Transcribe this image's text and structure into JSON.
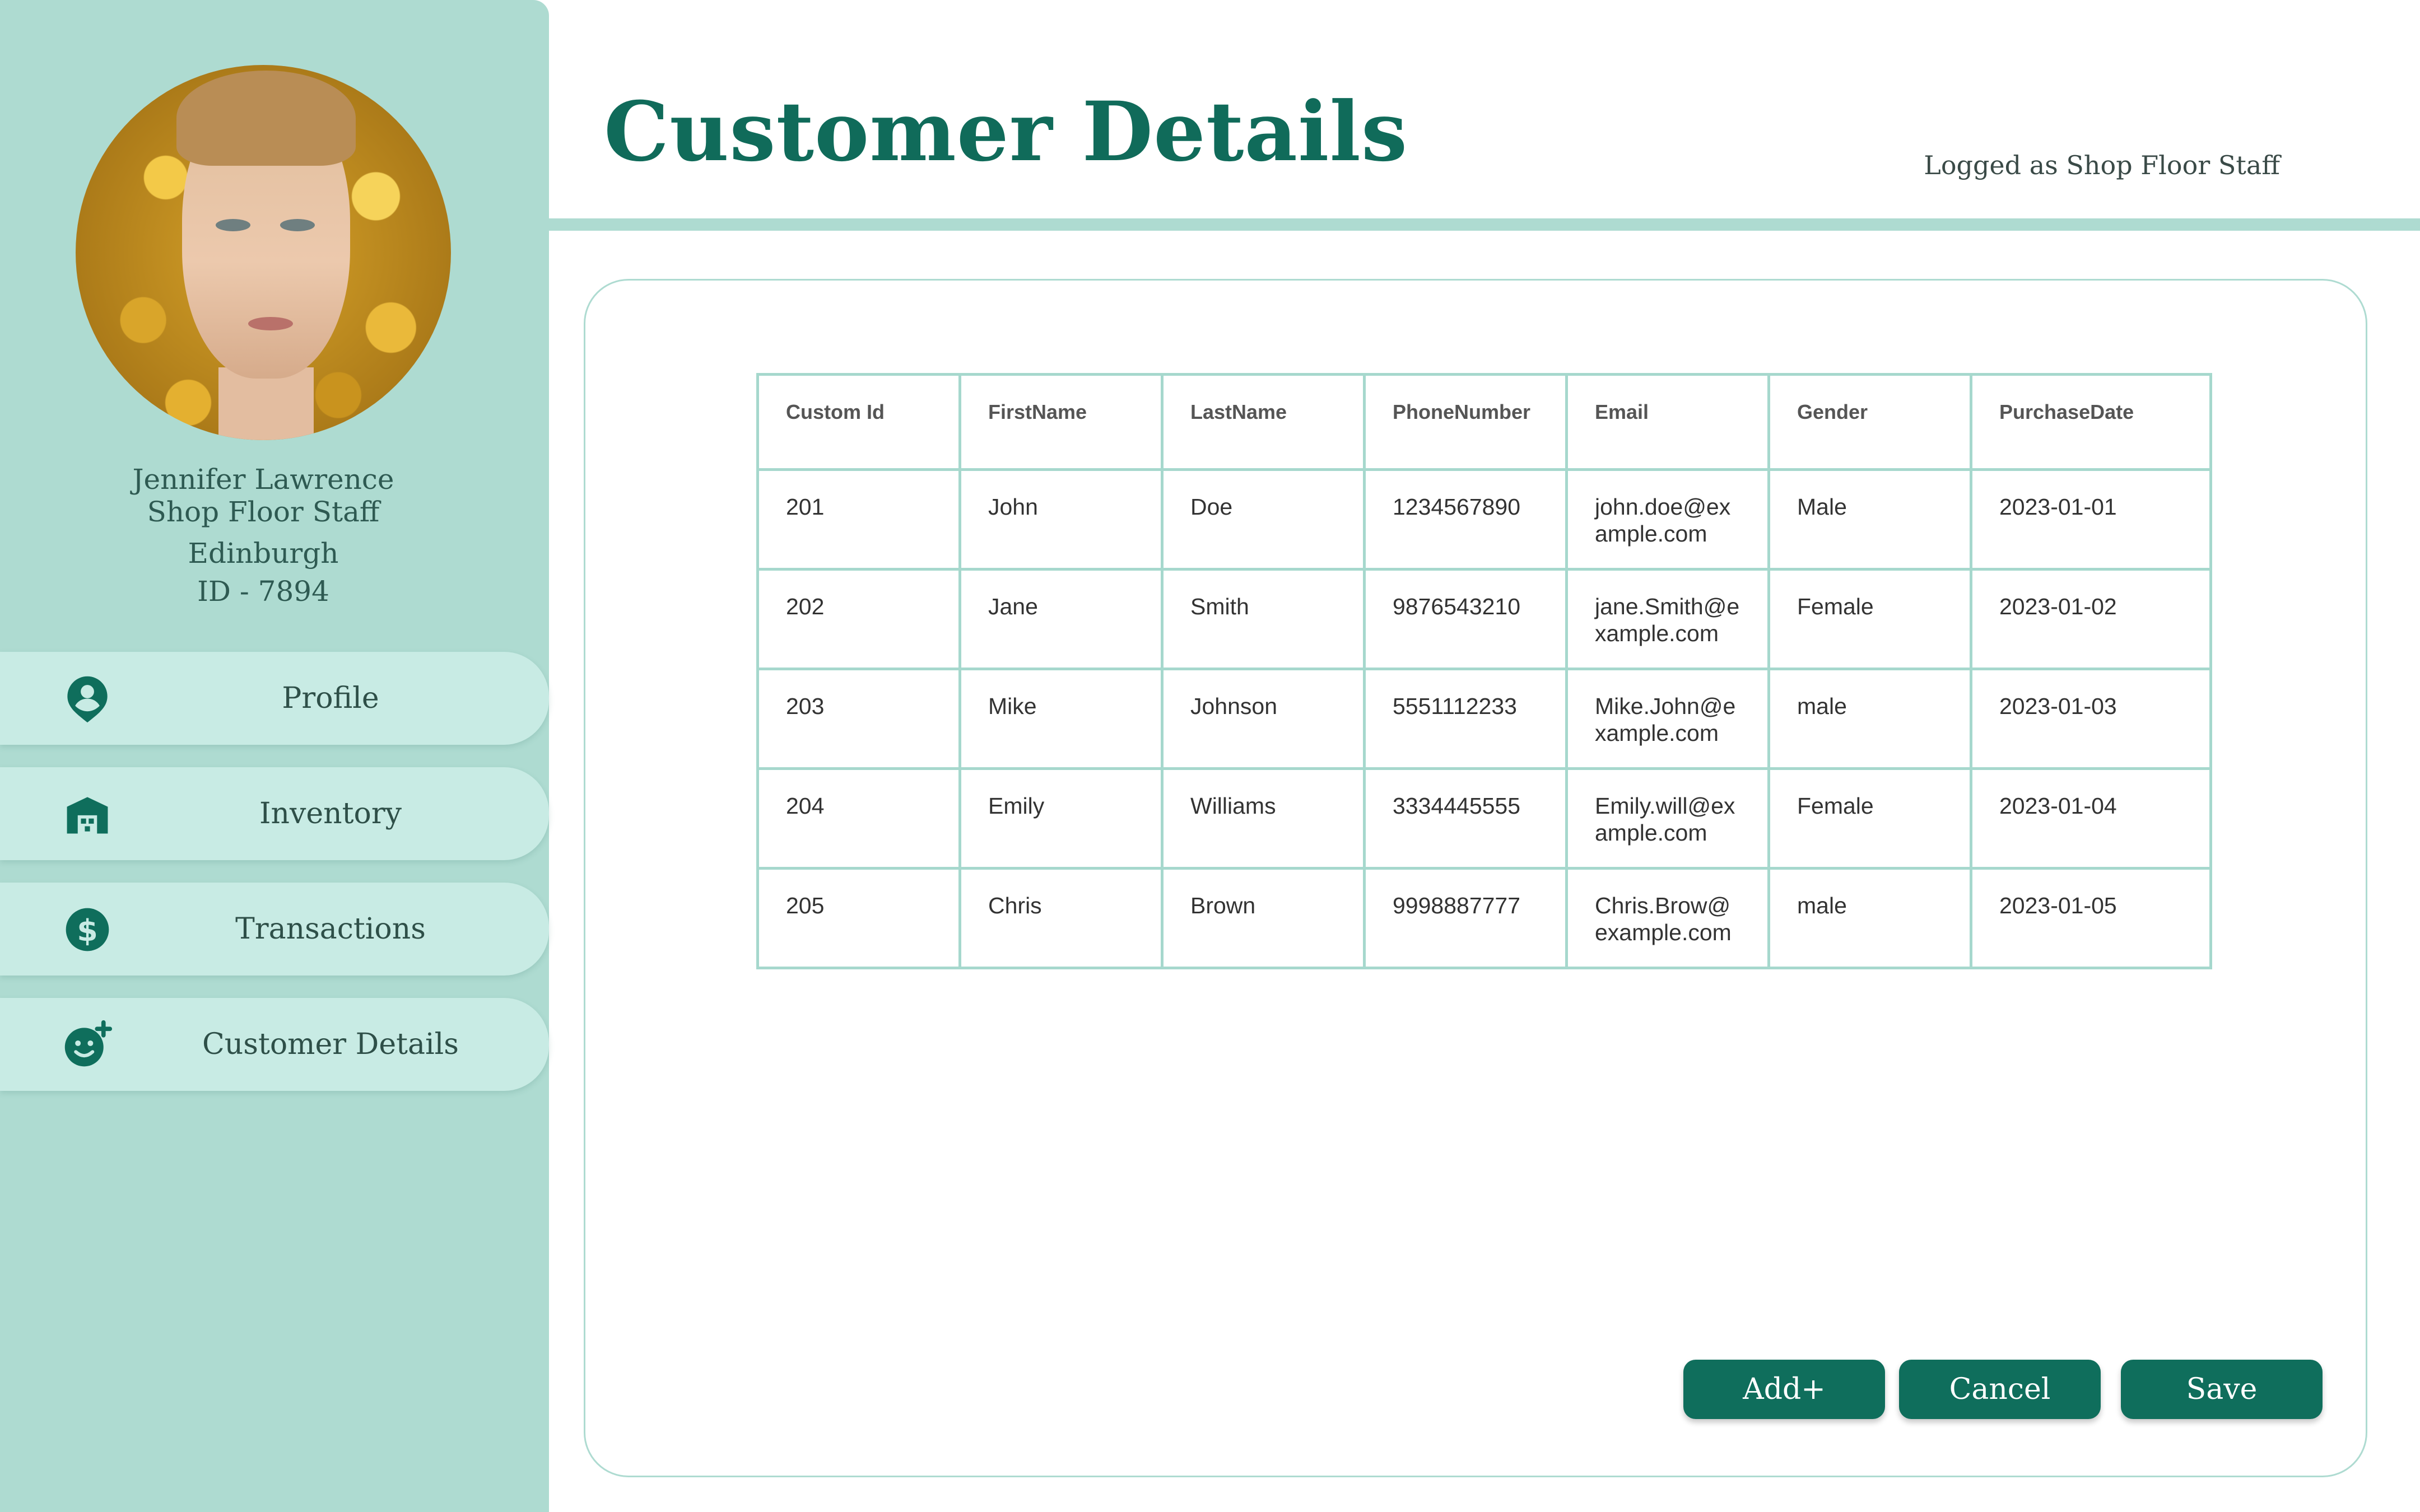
{
  "profile": {
    "name": "Jennifer Lawrence",
    "role": "Shop Floor Staff",
    "location": "Edinburgh",
    "id_label": "ID - 7894"
  },
  "sidebar": {
    "items": [
      {
        "label": "Profile",
        "icon": "user-pin-icon"
      },
      {
        "label": "Inventory",
        "icon": "warehouse-icon"
      },
      {
        "label": "Transactions",
        "icon": "dollar-icon"
      },
      {
        "label": "Customer Details",
        "icon": "add-user-icon"
      }
    ]
  },
  "header": {
    "title": "Customer Details",
    "logged_as": "Logged as Shop Floor Staff"
  },
  "table": {
    "columns": [
      "Custom Id",
      "FirstName",
      "LastName",
      "PhoneNumber",
      "Email",
      "Gender",
      "PurchaseDate"
    ],
    "rows": [
      [
        "201",
        "John",
        "Doe",
        "1234567890",
        "john.doe@example.com",
        "Male",
        "2023-01-01"
      ],
      [
        "202",
        "Jane",
        "Smith",
        "9876543210",
        "jane.Smith@example.com",
        "Female",
        "2023-01-02"
      ],
      [
        "203",
        "Mike",
        "Johnson",
        "5551112233",
        "Mike.John@example.com",
        "male",
        "2023-01-03"
      ],
      [
        "204",
        "Emily",
        "Williams",
        "3334445555",
        "Emily.will@example.com",
        "Female",
        "2023-01-04"
      ],
      [
        "205",
        "Chris",
        "Brown",
        "9998887777",
        "Chris.Brow@example.com",
        "male",
        "2023-01-05"
      ]
    ]
  },
  "buttons": {
    "add": "Add+",
    "cancel": "Cancel",
    "save": "Save"
  },
  "colors": {
    "accent": "#0f6e5c",
    "sidebar_bg": "#aedbd1",
    "nav_item_bg": "#c8ebe4",
    "table_border": "#a6d8cd"
  }
}
